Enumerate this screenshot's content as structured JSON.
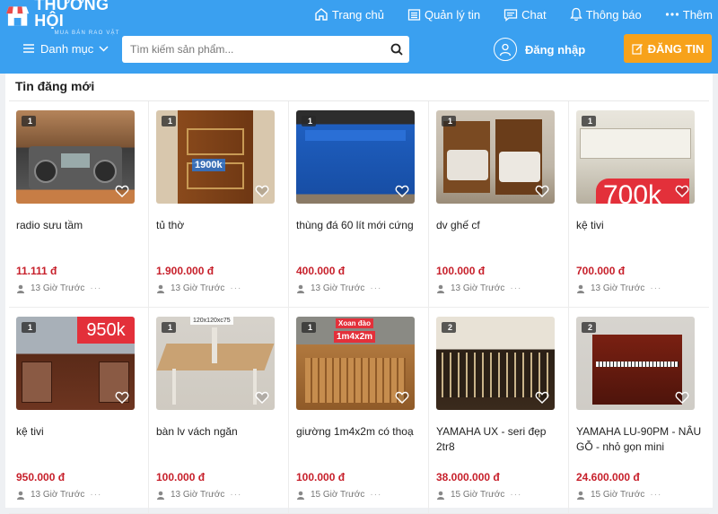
{
  "brand": {
    "name": "THƯƠNG HỘI",
    "tagline": "MUA BÁN RAO VẶT",
    "accent": "#3aa0f0",
    "post_color": "#f7a21b",
    "price_color": "#c7202b"
  },
  "nav": [
    {
      "label": "Trang chủ",
      "icon": "home-icon"
    },
    {
      "label": "Quản lý tin",
      "icon": "list-icon"
    },
    {
      "label": "Chat",
      "icon": "chat-icon"
    },
    {
      "label": "Thông báo",
      "icon": "bell-icon"
    },
    {
      "label": "Thêm",
      "icon": "more-icon"
    }
  ],
  "category_menu": {
    "label": "Danh mục"
  },
  "search": {
    "placeholder": "Tìm kiếm sản phẩm..."
  },
  "login": {
    "label": "Đăng nhập"
  },
  "post": {
    "label": "ĐĂNG TIN"
  },
  "section": {
    "title": "Tin đăng mới"
  },
  "listings": [
    {
      "title": "radio sưu tầm",
      "price": "11.111 đ",
      "time": "13 Giờ Trước",
      "images": "1"
    },
    {
      "title": "tủ thờ",
      "price": "1.900.000 đ",
      "time": "13 Giờ Trước",
      "images": "1",
      "overlay": "1900k"
    },
    {
      "title": "thùng đá 60 lít mới cứng",
      "price": "400.000 đ",
      "time": "13 Giờ Trước",
      "images": "1"
    },
    {
      "title": "dv ghế cf",
      "price": "100.000 đ",
      "time": "13 Giờ Trước",
      "images": "1"
    },
    {
      "title": "kệ tivi",
      "price": "700.000 đ",
      "time": "13 Giờ Trước",
      "images": "1",
      "overlay": "700k"
    },
    {
      "title": "kệ tivi",
      "price": "950.000 đ",
      "time": "13 Giờ Trước",
      "images": "1",
      "overlay": "950k"
    },
    {
      "title": "bàn lv vách ngăn",
      "price": "100.000 đ",
      "time": "13 Giờ Trước",
      "images": "1",
      "overlay": "120x120xc75"
    },
    {
      "title": "giường 1m4x2m có thoạ",
      "price": "100.000 đ",
      "time": "15 Giờ Trước",
      "images": "1",
      "overlay": "Xoan đào",
      "overlay2": "1m4x2m"
    },
    {
      "title": "YAMAHA UX - seri đẹp 2tr8",
      "price": "38.000.000 đ",
      "time": "15 Giờ Trước",
      "images": "2"
    },
    {
      "title": "YAMAHA LU-90PM - NÂU GỖ - nhỏ gọn mini",
      "price": "24.600.000 đ",
      "time": "15 Giờ Trước",
      "images": "2"
    }
  ],
  "watermark": "THƯƠNG HỘI"
}
